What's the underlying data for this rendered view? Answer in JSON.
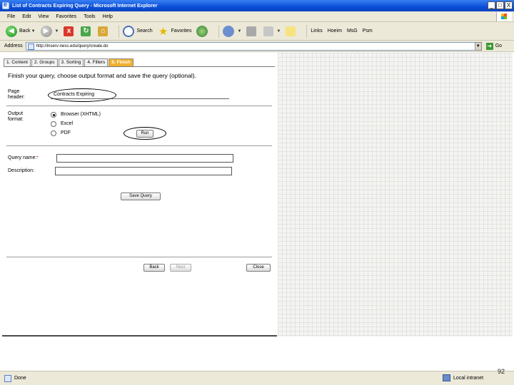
{
  "window": {
    "title": "List of Contracts Expiring Query - Microsoft Internet Explorer",
    "controls": {
      "minimize": "_",
      "maximize": "□",
      "close": "X"
    }
  },
  "menu": [
    "File",
    "Edit",
    "View",
    "Favorites",
    "Tools",
    "Help"
  ],
  "toolbar": {
    "back": "Back",
    "search": "Search",
    "favorites": "Favorites",
    "links": [
      "Links",
      "Hoeim",
      "MsG",
      "Psm"
    ]
  },
  "address": {
    "label": "Address",
    "url": "http://inserv-ness.edu/query/create.do",
    "go": "Go"
  },
  "tabs": [
    {
      "label": "1. Content",
      "active": false
    },
    {
      "label": "2. Groups",
      "active": false
    },
    {
      "label": "3. Sorting",
      "active": false
    },
    {
      "label": "4. Filters",
      "active": false
    },
    {
      "label": "5. Finish",
      "active": true
    }
  ],
  "form": {
    "heading": "Finish your query, choose output format and save the query (optional).",
    "page_header": {
      "label_line1": "Page",
      "label_line2": "header:",
      "value": "Contracts Expiring"
    },
    "output_format": {
      "label_line1": "Output",
      "label_line2": "format:",
      "options": [
        {
          "label": "Browser (XHTML)",
          "checked": true
        },
        {
          "label": "Excel",
          "checked": false
        },
        {
          "label": "PDF",
          "checked": false
        }
      ],
      "run_button": "Run"
    },
    "query_name": {
      "label": "Query name:",
      "required_mark": "*",
      "value": ""
    },
    "description": {
      "label": "Description:",
      "value": ""
    },
    "save_button": "Save Query",
    "nav": {
      "back": "Back",
      "next": "Next",
      "close": "Close"
    }
  },
  "status": {
    "text": "Done",
    "zone": "Local intranet"
  },
  "slide_number": "92"
}
